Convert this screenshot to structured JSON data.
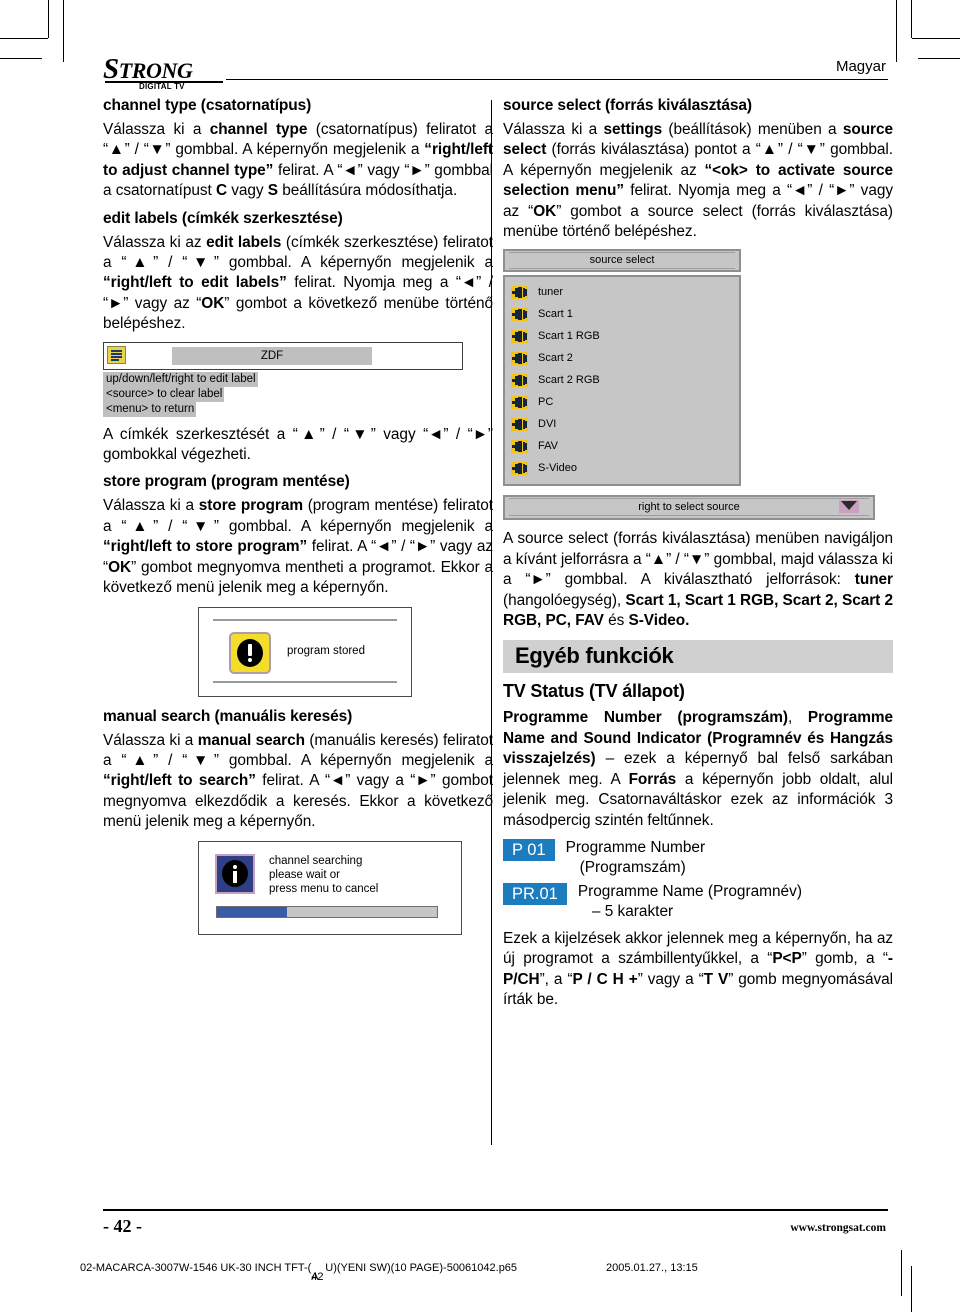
{
  "brand": {
    "logo_text": "STRONG",
    "logo_sub": "DIGITAL TV"
  },
  "header": {
    "language": "Magyar"
  },
  "left_column": {
    "section_channel_type": {
      "heading": "channel type (csatornatípus)",
      "paragraph_1_html": "Válassza ki a <b>channel type</b> (csatornatípus) feliratot a “▲” / “▼” gombbal. A képernyőn megjelenik a <b>“right/left to adjust channel type”</b> felirat. A “◄” vagy “►” gombbal a csatornatípust <b>C</b> vagy <b>S</b> beállításúra módosíthatja."
    },
    "section_edit_labels": {
      "heading": "edit labels (címkék szerkesztése)",
      "paragraph_1_html": "Válassza ki az <b>edit labels</b> (címkék szerkesztése) feliratot a “▲” / “▼” gombbal. A képernyőn megjelenik a <b>“right/left to edit labels”</b> felirat. Nyomja meg a “◄” / “►” vagy az “<b>OK</b>” gombot a következő menübe történő belépéshez.",
      "paragraph_2_html": "A címkék szerkesztését a “▲” / “▼” vagy “◄” / “►” gombokkal végezheti."
    },
    "osd_edit_labels": {
      "label_value": "ZDF",
      "hint_1": "up/down/left/right to edit label",
      "hint_2": "<source> to clear label",
      "hint_3": "<menu> to return"
    },
    "section_store_program": {
      "heading": "store program (program mentése)",
      "paragraph_1_html": "Válassza ki a <b>store program</b> (program mentése) feliratot a “▲” / “▼” gombbal. A képernyőn megjelenik a <b>“right/left to store program”</b> felirat. A “◄” / “►” vagy az “<b>OK</b>” gombot megnyomva mentheti a programot. Ekkor a következő menü jelenik meg a képernyőn."
    },
    "osd_program_stored": {
      "message": "program stored"
    },
    "section_manual_search": {
      "heading": "manual search (manuális keresés)",
      "paragraph_1_html": "Válassza ki a <b>manual search</b> (manuális keresés) feliratot a “▲” / “▼” gombbal. A képernyőn megjelenik a <b>“right/left to search”</b> felirat. A “◄” vagy a “►” gombot megnyomva elkezdődik a keresés. Ekkor a következő menü jelenik meg a képernyőn."
    },
    "osd_channel_searching": {
      "line_1": "channel searching",
      "line_2": "please wait or",
      "line_3": "press menu to cancel",
      "progress_percent": 32
    }
  },
  "right_column": {
    "section_source_select": {
      "heading": "source select (forrás kiválasztása)",
      "paragraph_1_html": "Válassza ki a <b>settings</b> (beállítások) menüben a <b>source select</b> (forrás kiválasztása) pontot a “▲” / “▼” gombbal. A képernyőn megjelenik az <b>“&lt;ok&gt; to activate source selection menu”</b> felirat. Nyomja meg a “◄” / “►” vagy az “<b>OK</b>” gombot a source select (forrás kiválasztása) menübe történő belépéshez.",
      "paragraph_2_html": "A source select (forrás kiválasztása) menüben navigáljon a kívánt jelforrásra a “▲” / “▼” gombbal, majd válassza ki a “►” gombbal. A kiválasztható jelforrások: <b>tuner</b> (hangolóegység), <b>Scart 1, Scart 1 RGB, Scart 2, Scart 2 RGB, PC, FAV</b> és <b>S-Video.</b>"
    },
    "osd_source_select": {
      "title": "source select",
      "items": [
        "tuner",
        "Scart 1",
        "Scart 1 RGB",
        "Scart 2",
        "Scart 2 RGB",
        "PC",
        "DVI",
        "FAV",
        "S-Video"
      ],
      "footer": "right to select source"
    },
    "chapter": {
      "band_title": "Egyéb funkciók",
      "subheading": "TV Status (TV állapot)",
      "paragraph_1_html": "<b>Programme Number (programszám)</b>, <b>Programme Name and Sound Indicator (Programnév és Hangzás visszajelzés)</b> – ezek a képernyő bal felső sarkában jelennek meg. A <b>Forrás</b> a képernyőn jobb oldalt, alul jelenik meg. Csatornaváltáskor ezek az információk 3 másodpercig szintén feltűnnek.",
      "chips": [
        {
          "chip": "P 01",
          "line_1": "Programme Number",
          "line_2": "(Programszám)"
        },
        {
          "chip": "PR.01",
          "line_1": "Programme Name (Programnév)",
          "line_2": "– 5 karakter"
        }
      ],
      "paragraph_2_html": "Ezek a kijelzések akkor jelennek meg a képernyőn, ha az új programot a számbillentyűkkel, a “<b>P&lt;P</b>” gomb, a “<b>-P/CH</b>”, a “<b>P / C H +</b>” vagy a “<b>T V</b>” gomb megnyomásával írták be."
    }
  },
  "footer": {
    "page_number": "- 42 -",
    "website": "www.strongsat.com",
    "file_prefix": "02-MACARCA-3007W-1546 UK-30 INCH TFT-(",
    "file_overlap_a": "A",
    "file_overlap_b": "42",
    "file_suffix": "U)(YENI SW)(10 PAGE)-50061042.p65",
    "timestamp": "2005.01.27., 13:15"
  },
  "colors": {
    "chip_blue": "#1c7cc0",
    "osd_gray": "#c6c6c6",
    "band_gray": "#d0d0d0",
    "progress_blue": "#3a5aa8",
    "warn_yellow": "#f2dd2b",
    "info_blue": "#2e3f86",
    "plug_yellow": "#f0c419"
  }
}
